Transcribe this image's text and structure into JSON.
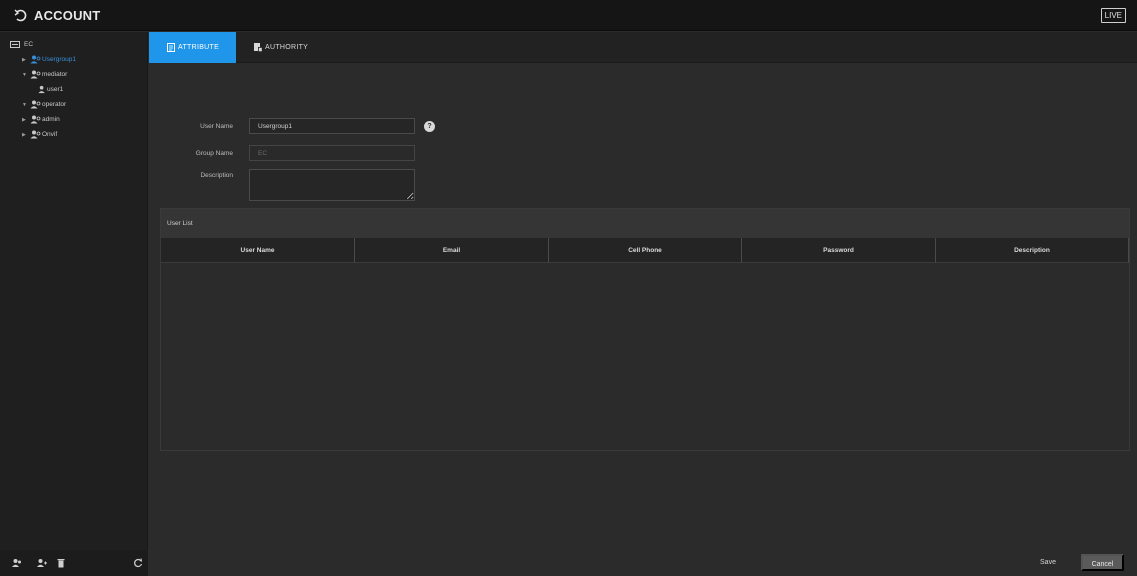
{
  "titlebar": {
    "title": "ACCOUNT",
    "live_label": "LIVE"
  },
  "sidebar": {
    "root": "EC",
    "items": [
      {
        "label": "Usergroup1",
        "type": "group",
        "expanded": false,
        "selected": true
      },
      {
        "label": "mediator",
        "type": "group",
        "expanded": true,
        "selected": false
      },
      {
        "label": "user1",
        "type": "user",
        "expanded": false,
        "selected": false
      },
      {
        "label": "operator",
        "type": "group",
        "expanded": true,
        "selected": false
      },
      {
        "label": "admin",
        "type": "group",
        "expanded": false,
        "selected": false
      },
      {
        "label": "Onvif",
        "type": "group",
        "expanded": false,
        "selected": false
      }
    ],
    "bottom_icons": [
      "add-group-icon",
      "add-user-icon",
      "delete-icon",
      "refresh-icon"
    ]
  },
  "tabs": [
    {
      "label": "ATTRIBUTE",
      "icon": "attribute-icon",
      "active": true
    },
    {
      "label": "AUTHORITY",
      "icon": "authority-icon",
      "active": false
    }
  ],
  "form": {
    "user_name_label": "User Name",
    "user_name_value": "Usergroup1",
    "group_name_label": "Group Name",
    "group_name_value": "EC",
    "description_label": "Description",
    "description_value": ""
  },
  "user_list": {
    "title": "User List",
    "columns": [
      "User Name",
      "Email",
      "Cell Phone",
      "Password",
      "Description"
    ],
    "rows": []
  },
  "footer": {
    "save_label": "Save",
    "cancel_label": "Cancel"
  },
  "colors": {
    "accent": "#1f96e9",
    "selected_text": "#3a8fd9"
  }
}
